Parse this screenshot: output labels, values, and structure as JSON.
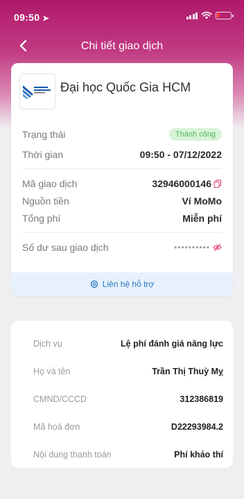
{
  "status_bar": {
    "time": "09:50",
    "location_icon": "location-arrow-icon",
    "battery_color": "#ff3b3b"
  },
  "nav": {
    "title": "Chi tiết giao dịch",
    "back_icon": "chevron-left-icon"
  },
  "merchant": {
    "name": "Đại học Quốc Gia HCM",
    "logo_text": "ĐẠI HỌC QUỐC GIA"
  },
  "status": {
    "label": "Trạng thái",
    "value": "Thành công",
    "color": "#54b35a"
  },
  "time": {
    "label": "Thời gian",
    "value": "09:50 - 07/12/2022"
  },
  "transaction_id": {
    "label": "Mã giao dịch",
    "value": "32946000146",
    "icon": "copy-icon"
  },
  "source": {
    "label": "Nguồn tiền",
    "value": "Ví MoMo"
  },
  "fee": {
    "label": "Tổng phí",
    "value": "Miễn phí"
  },
  "balance": {
    "label": "Số dư sau giao dịch",
    "value": "••••••••••",
    "icon": "eye-hidden-icon"
  },
  "support": {
    "label": "Liên hệ hỗ trợ",
    "icon": "support-icon",
    "color": "#2a77c4"
  },
  "details": [
    {
      "label": "Dịch vụ",
      "value": "Lệ phí đánh giá năng lực"
    },
    {
      "label": "Họ và tên",
      "value": "Trần Thị Thuỳ Mỵ"
    },
    {
      "label": "CMND/CCCD",
      "value": "312386819"
    },
    {
      "label": "Mã hoá đơn",
      "value": "D22293984.2"
    },
    {
      "label": "Nội dung thanh toán",
      "value": "Phí khảo thí"
    }
  ],
  "theme": {
    "accent": "#b0196b"
  }
}
